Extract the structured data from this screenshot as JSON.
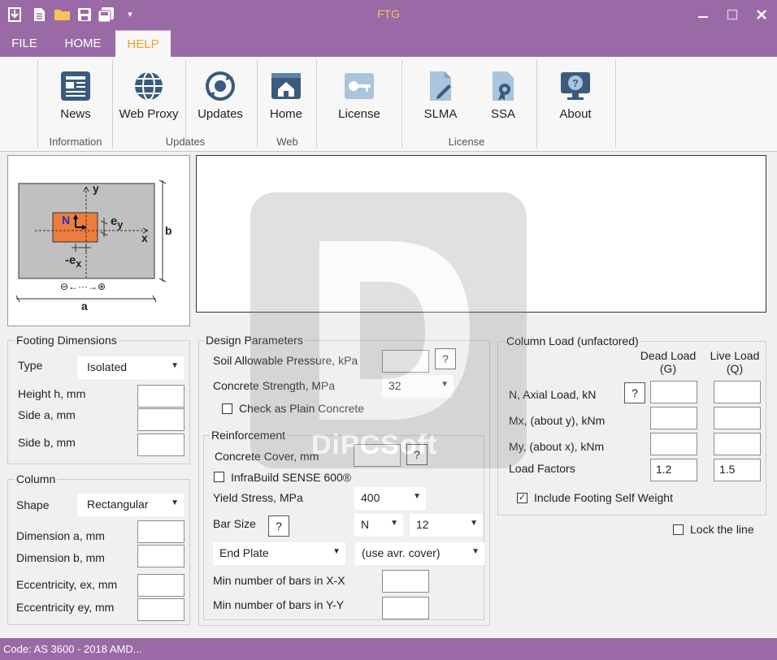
{
  "app": {
    "title": "FTG"
  },
  "tabs": [
    {
      "label": "FILE",
      "active": false
    },
    {
      "label": "HOME",
      "active": false
    },
    {
      "label": "HELP",
      "active": true
    }
  ],
  "ribbon": {
    "buttons": {
      "news": "News",
      "web_proxy": "Web Proxy",
      "updates": "Updates",
      "home": "Home",
      "license": "License",
      "slma": "SLMA",
      "ssa": "SSA",
      "about": "About"
    },
    "groups": {
      "information": "Information",
      "updates": "Updates",
      "web": "Web",
      "license": "License"
    }
  },
  "diagram": {
    "y_label": "y",
    "x_label": "x",
    "n_label": "N",
    "ey_label": "e",
    "ey_sub": "y",
    "ex_label": "-e",
    "ex_sub": "x",
    "b_label": "b",
    "a_label": "a",
    "sign_row": "⊖←···→⊕"
  },
  "footing": {
    "legend": "Footing Dimensions",
    "type_label": "Type",
    "type_value": "Isolated",
    "height_label": "Height h, mm",
    "side_a_label": "Side a, mm",
    "side_b_label": "Side b, mm",
    "height_value": "",
    "side_a_value": "",
    "side_b_value": ""
  },
  "column": {
    "legend": "Column",
    "shape_label": "Shape",
    "shape_value": "Rectangular",
    "dim_a_label": "Dimension a, mm",
    "dim_b_label": "Dimension b, mm",
    "ecc_x_label": "Eccentricity, ex, mm",
    "ecc_y_label": "Eccentricity ey, mm"
  },
  "design": {
    "legend": "Design Parameters",
    "soil_label": "Soil Allowable Pressure, kPa",
    "concrete_label": "Concrete Strength, MPa",
    "concrete_value": "32",
    "plain_label": "Check as Plain Concrete",
    "help": "?"
  },
  "reinforcement": {
    "legend": "Reinforcement",
    "cover_label": "Concrete Cover, mm",
    "infrabuild_label": "InfraBuild SENSE 600®",
    "yield_label": "Yield Stress, MPa",
    "yield_value": "400",
    "bar_size_label": "Bar Size",
    "bar_type_value": "N",
    "bar_size_value": "12",
    "end_value": "End Plate",
    "cover_mode_value": "(use avr. cover)",
    "min_x_label": "Min number of bars in X-X",
    "min_y_label": "Min number of bars in Y-Y"
  },
  "load": {
    "legend": "Column Load (unfactored)",
    "dead_header": "Dead Load",
    "dead_sub": "(G)",
    "live_header": "Live Load",
    "live_sub": "(Q)",
    "axial_label": "N, Axial Load, kN",
    "mx_label": "Mx, (about y), kNm",
    "my_label": "My, (about x), kNm",
    "factors_label": "Load Factors",
    "dead_factor": "1.2",
    "live_factor": "1.5",
    "self_weight_label": "Include Footing Self Weight"
  },
  "lock_label": "Lock the line",
  "watermark_text": "DiPCSoft",
  "status": "Code: AS 3600 - 2018   AMD..."
}
